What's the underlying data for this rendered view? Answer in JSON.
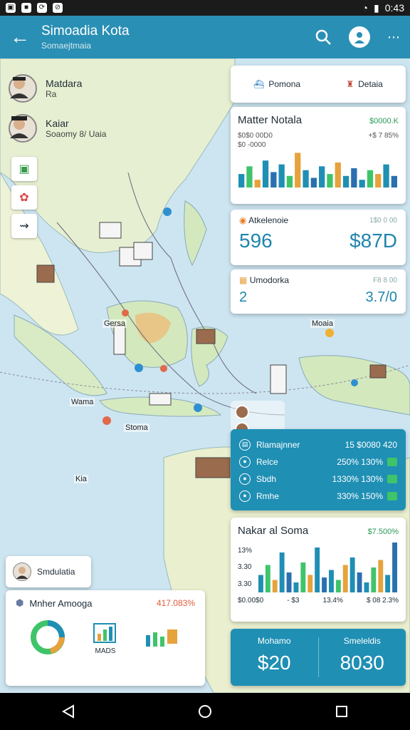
{
  "status_bar": {
    "time": "0:43"
  },
  "app_bar": {
    "title": "Simoadia Kota",
    "subtitle": "Somaejtmaia"
  },
  "map": {
    "people": [
      {
        "name": "Matdara",
        "sub": "Ra"
      },
      {
        "name": "Kaiar",
        "sub": "Soaomy 8/ Uaia"
      }
    ],
    "labels": {
      "gersa": "Gersa",
      "mooa": "Moaia",
      "wama": "Wama",
      "stoma": "Stoma",
      "kia": "Kia"
    }
  },
  "chips": {
    "chip1": "Pomona",
    "chip2": "Detaia"
  },
  "chart1": {
    "title": "Matter Notala",
    "value": "$0000.K",
    "line1_left": "$0$0 00D0",
    "line1_right": "+$ 7 85%",
    "line2_left": "$0 -0000"
  },
  "stat1": {
    "label": "Atkelenoie",
    "hint": "1$0 0 00",
    "value_left": "596",
    "value_right": "$87D"
  },
  "stat2": {
    "label": "Umodorka",
    "hint": "F8 8 00",
    "value_left": "2",
    "value_right": "3.7/0"
  },
  "table": {
    "rows": [
      {
        "label": "Rlamajnner",
        "value": "15 $0080 420"
      },
      {
        "label": "Relce",
        "value": "250% 130%"
      },
      {
        "label": "Sbdh",
        "value": "1330% 130%"
      },
      {
        "label": "Rmhe",
        "value": "330% 150%"
      }
    ]
  },
  "chart2": {
    "title": "Nakar al Soma",
    "value": "$7.500%",
    "ylabel1": "13%",
    "ylabel2": "3.30",
    "ylabel3": "3.30",
    "x1": "$0.00$0",
    "x2": "- $3",
    "x3": "13.4%",
    "x4": "$ 08 2.3%"
  },
  "totals": {
    "left_label": "Mohamo",
    "left_value": "$20",
    "right_label": "Smeleldis",
    "right_value": "8030"
  },
  "profile_chip": {
    "name": "Smdulatia"
  },
  "bottom_card": {
    "title": "Mnher Amooga",
    "pct": "417.083%",
    "caption": "MADS"
  },
  "colors": {
    "accent": "#1f8fb4",
    "green": "#3fc46a",
    "orange": "#e6a23c"
  }
}
